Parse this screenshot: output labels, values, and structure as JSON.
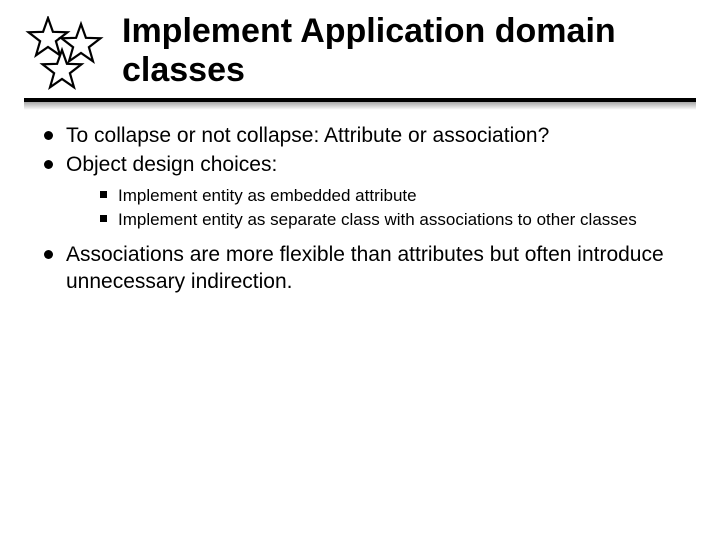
{
  "title": "Implement Application domain classes",
  "bullets": {
    "b1": "To collapse or not collapse: Attribute or association?",
    "b2": "Object design choices:",
    "sub": {
      "s1": "Implement entity as embedded attribute",
      "s2": "Implement entity as separate class with associations to other classes"
    },
    "b3": "Associations are more flexible than attributes but often introduce unnecessary indirection."
  }
}
